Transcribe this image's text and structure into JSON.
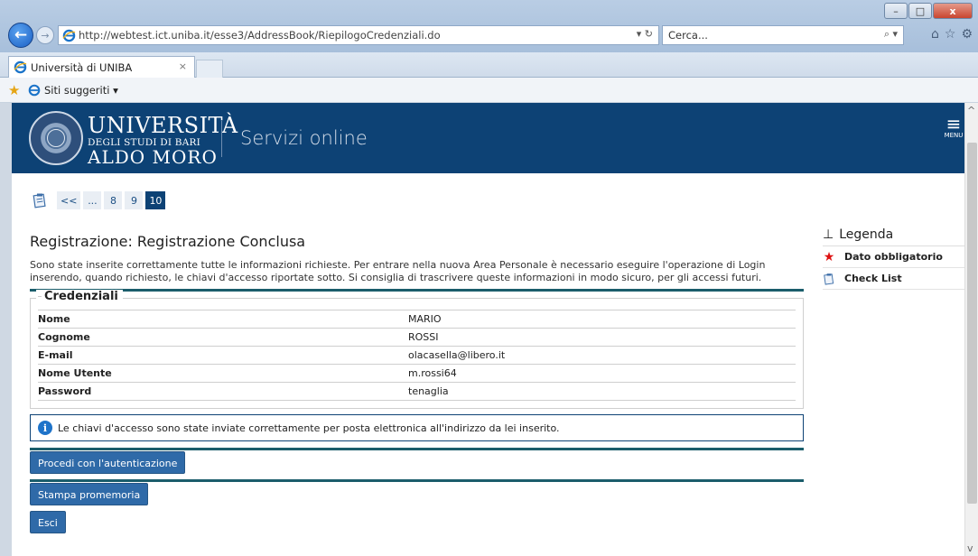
{
  "browser": {
    "url": "http://webtest.ict.uniba.it/esse3/AddressBook/RiepilogoCredenziali.do",
    "search_placeholder": "Cerca...",
    "tab_title": "Università di UNIBA",
    "tab_close": "×",
    "favorites_label": "Siti suggeriti ▾",
    "window_controls": {
      "minimize": "–",
      "maximize": "□",
      "close": "x"
    }
  },
  "site": {
    "logo_line1": "UNIVERSITÀ",
    "logo_line2": "DEGLI STUDI DI BARI",
    "logo_line3": "ALDO MORO",
    "section": "Servizi online",
    "menu_label": "MENU"
  },
  "pager": {
    "items": [
      "<<",
      "...",
      "8",
      "9",
      "10"
    ],
    "active": "10"
  },
  "page": {
    "title": "Registrazione: Registrazione Conclusa",
    "intro": "Sono state inserite correttamente tutte le informazioni richieste. Per entrare nella nuova Area Personale è necessario eseguire l'operazione di Login inserendo, quando richiesto, le chiavi d'accesso riportate sotto. Si consiglia di trascrivere queste informazioni in modo sicuro, per gli accessi futuri.",
    "credentials_legend": "Credenziali",
    "credentials": [
      {
        "label": "Nome",
        "value": "MARIO"
      },
      {
        "label": "Cognome",
        "value": "ROSSI"
      },
      {
        "label": "E-mail",
        "value": "olacasella@libero.it"
      },
      {
        "label": "Nome Utente",
        "value": "m.rossi64"
      },
      {
        "label": "Password",
        "value": "tenaglia"
      }
    ],
    "info_message": "Le chiavi d'accesso sono state inviate correttamente per posta elettronica all'indirizzo da lei inserito.",
    "btn_auth": "Procedi con l'autenticazione",
    "btn_print": "Stampa promemoria",
    "btn_exit": "Esci"
  },
  "legend": {
    "title": "Legenda",
    "items": [
      {
        "label": "Dato obbligatorio",
        "icon": "asterisk-icon"
      },
      {
        "label": "Check List",
        "icon": "checklist-icon"
      }
    ]
  },
  "colors": {
    "header_bg": "#0d4275",
    "button_bg": "#2f6aa8",
    "rule": "#1b5d6b"
  }
}
